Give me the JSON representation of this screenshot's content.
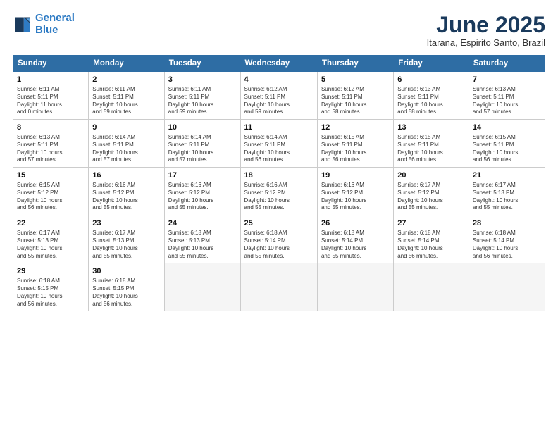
{
  "logo": {
    "line1": "General",
    "line2": "Blue"
  },
  "title": "June 2025",
  "subtitle": "Itarana, Espirito Santo, Brazil",
  "headers": [
    "Sunday",
    "Monday",
    "Tuesday",
    "Wednesday",
    "Thursday",
    "Friday",
    "Saturday"
  ],
  "weeks": [
    [
      {
        "day": "1",
        "info": "Sunrise: 6:11 AM\nSunset: 5:11 PM\nDaylight: 11 hours\nand 0 minutes."
      },
      {
        "day": "2",
        "info": "Sunrise: 6:11 AM\nSunset: 5:11 PM\nDaylight: 10 hours\nand 59 minutes."
      },
      {
        "day": "3",
        "info": "Sunrise: 6:11 AM\nSunset: 5:11 PM\nDaylight: 10 hours\nand 59 minutes."
      },
      {
        "day": "4",
        "info": "Sunrise: 6:12 AM\nSunset: 5:11 PM\nDaylight: 10 hours\nand 59 minutes."
      },
      {
        "day": "5",
        "info": "Sunrise: 6:12 AM\nSunset: 5:11 PM\nDaylight: 10 hours\nand 58 minutes."
      },
      {
        "day": "6",
        "info": "Sunrise: 6:13 AM\nSunset: 5:11 PM\nDaylight: 10 hours\nand 58 minutes."
      },
      {
        "day": "7",
        "info": "Sunrise: 6:13 AM\nSunset: 5:11 PM\nDaylight: 10 hours\nand 57 minutes."
      }
    ],
    [
      {
        "day": "8",
        "info": "Sunrise: 6:13 AM\nSunset: 5:11 PM\nDaylight: 10 hours\nand 57 minutes."
      },
      {
        "day": "9",
        "info": "Sunrise: 6:14 AM\nSunset: 5:11 PM\nDaylight: 10 hours\nand 57 minutes."
      },
      {
        "day": "10",
        "info": "Sunrise: 6:14 AM\nSunset: 5:11 PM\nDaylight: 10 hours\nand 57 minutes."
      },
      {
        "day": "11",
        "info": "Sunrise: 6:14 AM\nSunset: 5:11 PM\nDaylight: 10 hours\nand 56 minutes."
      },
      {
        "day": "12",
        "info": "Sunrise: 6:15 AM\nSunset: 5:11 PM\nDaylight: 10 hours\nand 56 minutes."
      },
      {
        "day": "13",
        "info": "Sunrise: 6:15 AM\nSunset: 5:11 PM\nDaylight: 10 hours\nand 56 minutes."
      },
      {
        "day": "14",
        "info": "Sunrise: 6:15 AM\nSunset: 5:11 PM\nDaylight: 10 hours\nand 56 minutes."
      }
    ],
    [
      {
        "day": "15",
        "info": "Sunrise: 6:15 AM\nSunset: 5:12 PM\nDaylight: 10 hours\nand 56 minutes."
      },
      {
        "day": "16",
        "info": "Sunrise: 6:16 AM\nSunset: 5:12 PM\nDaylight: 10 hours\nand 55 minutes."
      },
      {
        "day": "17",
        "info": "Sunrise: 6:16 AM\nSunset: 5:12 PM\nDaylight: 10 hours\nand 55 minutes."
      },
      {
        "day": "18",
        "info": "Sunrise: 6:16 AM\nSunset: 5:12 PM\nDaylight: 10 hours\nand 55 minutes."
      },
      {
        "day": "19",
        "info": "Sunrise: 6:16 AM\nSunset: 5:12 PM\nDaylight: 10 hours\nand 55 minutes."
      },
      {
        "day": "20",
        "info": "Sunrise: 6:17 AM\nSunset: 5:12 PM\nDaylight: 10 hours\nand 55 minutes."
      },
      {
        "day": "21",
        "info": "Sunrise: 6:17 AM\nSunset: 5:13 PM\nDaylight: 10 hours\nand 55 minutes."
      }
    ],
    [
      {
        "day": "22",
        "info": "Sunrise: 6:17 AM\nSunset: 5:13 PM\nDaylight: 10 hours\nand 55 minutes."
      },
      {
        "day": "23",
        "info": "Sunrise: 6:17 AM\nSunset: 5:13 PM\nDaylight: 10 hours\nand 55 minutes."
      },
      {
        "day": "24",
        "info": "Sunrise: 6:18 AM\nSunset: 5:13 PM\nDaylight: 10 hours\nand 55 minutes."
      },
      {
        "day": "25",
        "info": "Sunrise: 6:18 AM\nSunset: 5:14 PM\nDaylight: 10 hours\nand 55 minutes."
      },
      {
        "day": "26",
        "info": "Sunrise: 6:18 AM\nSunset: 5:14 PM\nDaylight: 10 hours\nand 55 minutes."
      },
      {
        "day": "27",
        "info": "Sunrise: 6:18 AM\nSunset: 5:14 PM\nDaylight: 10 hours\nand 56 minutes."
      },
      {
        "day": "28",
        "info": "Sunrise: 6:18 AM\nSunset: 5:14 PM\nDaylight: 10 hours\nand 56 minutes."
      }
    ],
    [
      {
        "day": "29",
        "info": "Sunrise: 6:18 AM\nSunset: 5:15 PM\nDaylight: 10 hours\nand 56 minutes."
      },
      {
        "day": "30",
        "info": "Sunrise: 6:18 AM\nSunset: 5:15 PM\nDaylight: 10 hours\nand 56 minutes."
      },
      {
        "day": "",
        "info": ""
      },
      {
        "day": "",
        "info": ""
      },
      {
        "day": "",
        "info": ""
      },
      {
        "day": "",
        "info": ""
      },
      {
        "day": "",
        "info": ""
      }
    ]
  ]
}
